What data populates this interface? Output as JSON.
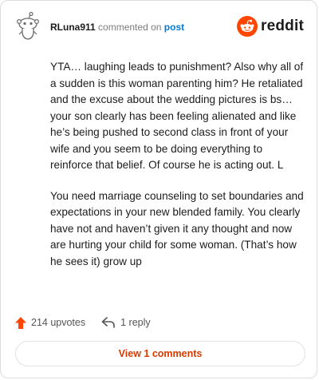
{
  "header": {
    "username": "RLuna911",
    "commented_on": "commented on",
    "post_link": "post",
    "brand": "reddit"
  },
  "comment": {
    "paragraphs": [
      "YTA… laughing leads to punishment? Also why all of a sudden is this woman parenting him? He retaliated and the excuse about the wedding pictures is bs… your son clearly has been feeling alienated and like he’s being pushed to second class in front of your wife and you seem to be doing everything to reinforce that belief. Of course he is acting out. L",
      "You need marriage counseling to set boundaries and expectations in your new blended family. You clearly have not and haven’t given it any thought and now are hurting your child for some woman. (That’s how he sees it) grow up"
    ]
  },
  "actions": {
    "upvotes": "214 upvotes",
    "reply": "1 reply"
  },
  "footer": {
    "view_comments": "View 1 comments"
  },
  "colors": {
    "accent": "#ff4500",
    "link": "#0079d3",
    "button_text": "#d93a00"
  },
  "icons": {
    "avatar": "snoo-avatar-icon",
    "brand": "reddit-logo-icon",
    "upvote": "upvote-arrow-icon",
    "reply": "reply-arrow-icon"
  }
}
